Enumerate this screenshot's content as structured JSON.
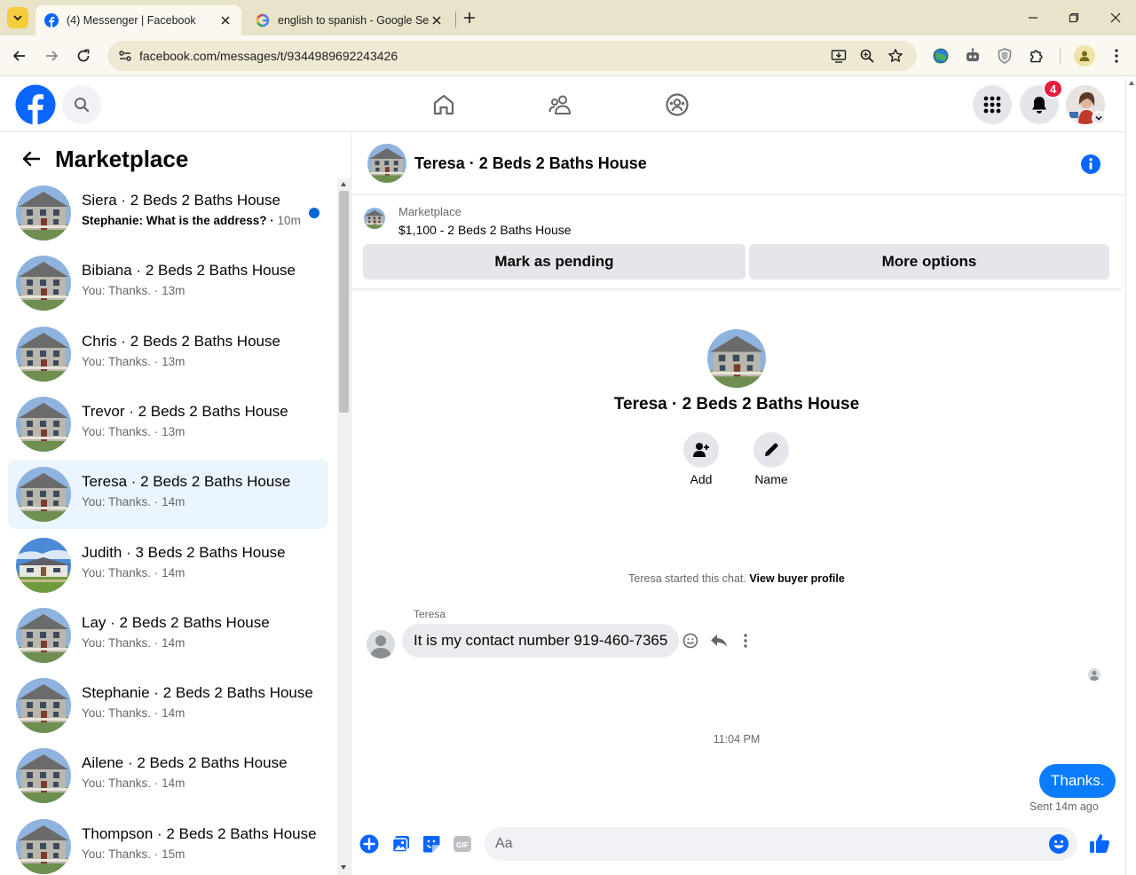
{
  "browser": {
    "tabs": [
      {
        "title": "(4) Messenger | Facebook",
        "active": true
      },
      {
        "title": "english to spanish - Google Sea",
        "active": false
      }
    ],
    "url": "facebook.com/messages/t/9344989692243426"
  },
  "header": {
    "notification_count": "4"
  },
  "sidebar": {
    "title": "Marketplace",
    "conversations": [
      {
        "name": "Siera · 2 Beds 2 Baths House",
        "preview": "Stephanie: What is the address? · ",
        "time": "10m",
        "unread": true
      },
      {
        "name": "Bibiana · 2 Beds 2 Baths House",
        "preview": "You: Thanks. · ",
        "time": "13m"
      },
      {
        "name": "Chris · 2 Beds 2 Baths House",
        "preview": "You: Thanks. · ",
        "time": "13m"
      },
      {
        "name": "Trevor · 2 Beds 2 Baths House",
        "preview": "You: Thanks. · ",
        "time": "13m"
      },
      {
        "name": "Teresa · 2 Beds 2 Baths House",
        "preview": "You: Thanks. · ",
        "time": "14m",
        "selected": true
      },
      {
        "name": "Judith · 3 Beds 2 Baths House",
        "preview": "You: Thanks. · ",
        "time": "14m"
      },
      {
        "name": "Lay · 2 Beds 2 Baths House",
        "preview": "You: Thanks. · ",
        "time": "14m"
      },
      {
        "name": "Stephanie · 2 Beds 2 Baths House",
        "preview": "You: Thanks. · ",
        "time": "14m"
      },
      {
        "name": "Ailene · 2 Beds 2 Baths House",
        "preview": "You: Thanks. · ",
        "time": "14m"
      },
      {
        "name": "Thompson · 2 Beds 2 Baths House",
        "preview": "You: Thanks. · ",
        "time": "15m"
      }
    ]
  },
  "chat": {
    "title": "Teresa · 2 Beds 2 Baths House",
    "marketplace": {
      "label": "Marketplace",
      "listing": "$1,100 - 2 Beds 2 Baths House",
      "pending_label": "Mark as pending",
      "more_label": "More options"
    },
    "profile": {
      "name": "Teresa · 2 Beds 2 Baths House",
      "add_label": "Add",
      "name_label": "Name"
    },
    "started_text": "Teresa started this chat.",
    "view_profile": "View buyer profile",
    "sender": "Teresa",
    "incoming": "It is my contact number 919-460-7365",
    "timestamp": "11:04 PM",
    "outgoing": "Thanks.",
    "sent_status": "Sent 14m ago",
    "composer_placeholder": "Aa"
  },
  "colors": {
    "brand_blue": "#0866ff",
    "bubble_out": "#0a7cff",
    "selected_row": "#ebf5ff",
    "notif_red": "#e41e3f"
  }
}
